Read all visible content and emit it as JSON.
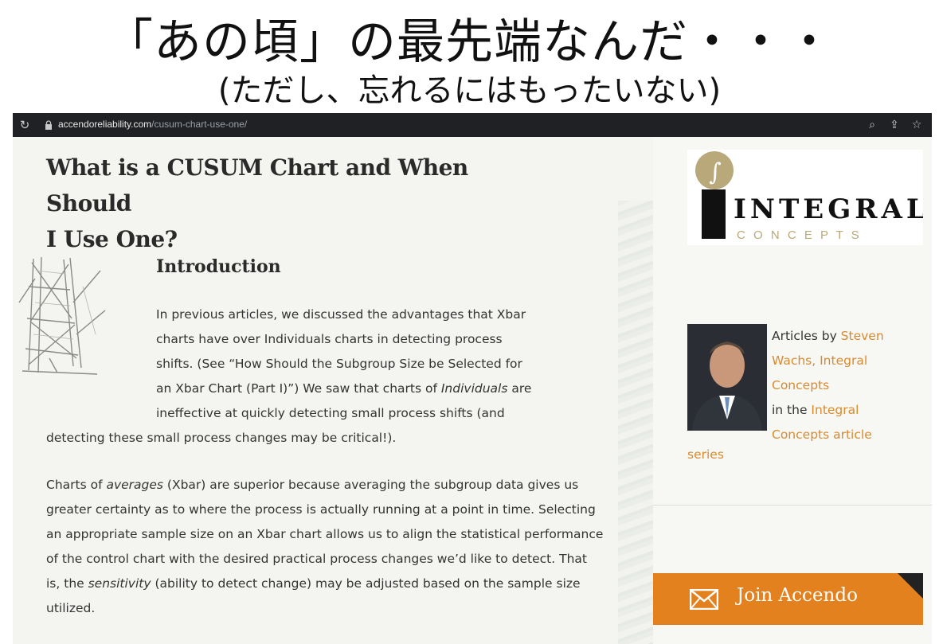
{
  "banner": {
    "title": "「あの頃」の最先端なんだ・・・",
    "subtitle": "(ただし、忘れるにはもったいない)"
  },
  "browser": {
    "url_domain": "accendoreliability.com",
    "url_path": "/cusum-chart-use-one/",
    "icons": [
      "reload-icon",
      "lock-icon",
      "zoom-icon",
      "share-icon",
      "bookmark-star-icon"
    ]
  },
  "article": {
    "title_line1": "What is a CUSUM Chart and When Should",
    "title_line2": "I Use One?",
    "intro_heading": "Introduction",
    "p1_lines": [
      "In previous articles, we discussed the advantages that Xbar",
      "charts have over Individuals charts in detecting process",
      "shifts.  (See “How Should the Subgroup Size be Selected for",
      "an Xbar Chart (Part I)”)  We saw that charts of ",
      "ineffective at quickly detecting small process shifts (and"
    ],
    "p1_italic": "Individuals",
    "p1_after_italic": " are",
    "p1_tail": "detecting these small process changes may be critical!).",
    "p2_start": "Charts of ",
    "p2_italic1": "averages",
    "p2_mid": " (Xbar) are superior because averaging the subgroup data gives us greater certainty as to where the process is actually running at a point in time.  Selecting an appropriate sample size on an Xbar chart allows us to align the statistical performance of the control chart with the desired practical process changes we’d like to detect.  That is, the ",
    "p2_italic2": "sensitivity",
    "p2_end": " (ability to detect change) may be adjusted based on the sample size utilized."
  },
  "sidebar": {
    "logo_main": "INTEGRAL",
    "logo_sub": "C O N C E P T S",
    "logo_glyph": "∫",
    "author_prefix": "Articles by ",
    "author_name_a": "Steven",
    "author_name_b": "Wachs, Integral",
    "author_name_c": "Concepts",
    "author_mid": "in the ",
    "series_a": "Integral",
    "series_b": "Concepts article",
    "series_c": "series",
    "join_label": "Join Accendo"
  },
  "colors": {
    "accent": "#e3811f",
    "link": "#d98a2e",
    "addressbar": "#202124",
    "page_bg": "#f4f4f0"
  }
}
